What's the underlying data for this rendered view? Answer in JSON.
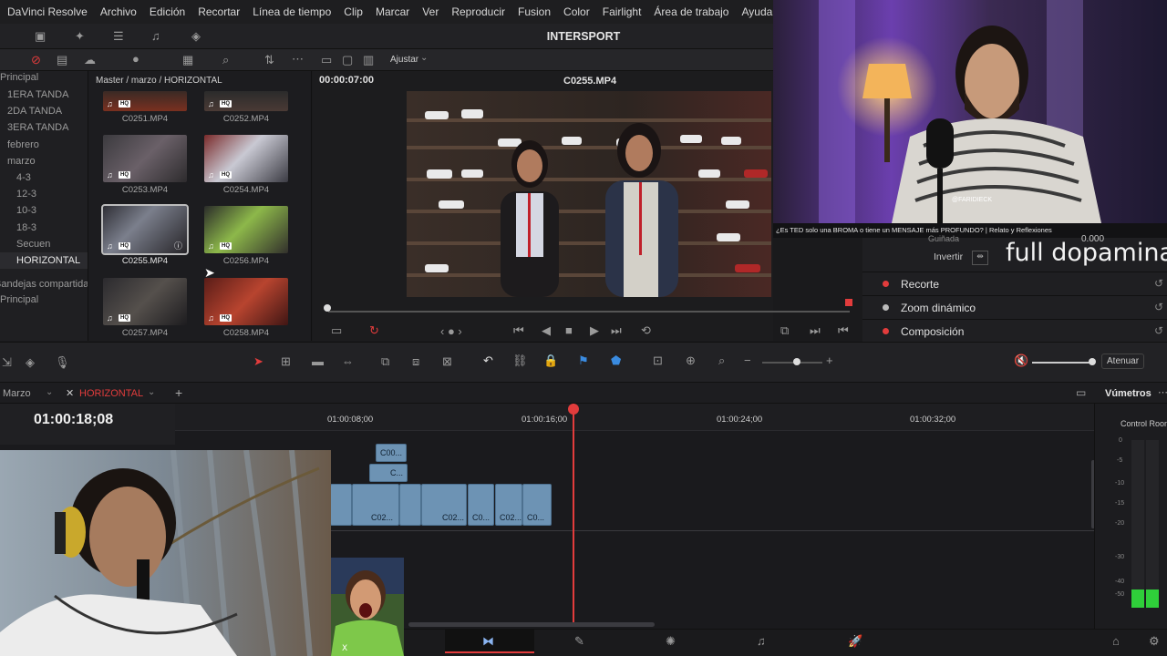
{
  "menu": {
    "items": [
      "DaVinci Resolve",
      "Archivo",
      "Edición",
      "Recortar",
      "Línea de tiempo",
      "Clip",
      "Marcar",
      "Ver",
      "Reproducir",
      "Fusion",
      "Color",
      "Fairlight",
      "Área de trabajo",
      "Ayuda"
    ]
  },
  "project": {
    "title": "INTERSPORT"
  },
  "viewer": {
    "zoom_label": "Ajustar",
    "timecode": "00:00:07:00",
    "clip_name": "C0255.MP4"
  },
  "bins": {
    "items": [
      "Principal",
      "1ERA TANDA",
      "2DA TANDA",
      "3ERA TANDA",
      "febrero",
      "marzo",
      "4-3",
      "12-3",
      "10-3",
      "18-3",
      "Secuen",
      "HORIZONTAL",
      "Bandejas compartidas",
      "Principal"
    ],
    "selected": "HORIZONTAL"
  },
  "media_pool": {
    "path": "Master / marzo / HORIZONTAL",
    "clips": [
      "C0251.MP4",
      "C0252.MP4",
      "C0253.MP4",
      "C0254.MP4",
      "C0255.MP4",
      "C0256.MP4",
      "C0257.MP4",
      "C0258.MP4"
    ],
    "hq_badge": "HQ",
    "selected": "C0255.MP4"
  },
  "cam": {
    "watermark": "@FARIDIECK",
    "caption": "¿Es TED solo una BROMA o tiene un MENSAJE más PROFUNDO? | Relato y Reflexiones"
  },
  "inspector": {
    "partial_label": "Guiñada",
    "partial_value": "0.000",
    "invert_label": "Invertir",
    "sections": [
      "Recorte",
      "Zoom dinámico",
      "Composición"
    ]
  },
  "overlay_text": "full dopamina",
  "audio": {
    "attenuate_label": "Atenuar"
  },
  "timeline": {
    "tabs": [
      "Marzo",
      "HORIZONTAL"
    ],
    "active_tab": "HORIZONTAL",
    "timecode": "01:00:18;08",
    "ruler": [
      "01:00:08;00",
      "01:00:16;00",
      "01:00:24;00",
      "01:00:32;00"
    ],
    "clips_v2": [
      "C00...",
      "C..."
    ],
    "clips_v1": [
      "C02...",
      "C02...",
      "C0...",
      "C02...",
      "C0..."
    ]
  },
  "meters": {
    "title": "Vúmetros",
    "subtitle": "Control Room",
    "scale": [
      "0",
      "-5",
      "-10",
      "-15",
      "-20",
      "-30",
      "-40",
      "-50"
    ]
  },
  "colors": {
    "accent": "#e23c3c",
    "clip": "#6d93b4",
    "panel": "#1f1f22"
  }
}
